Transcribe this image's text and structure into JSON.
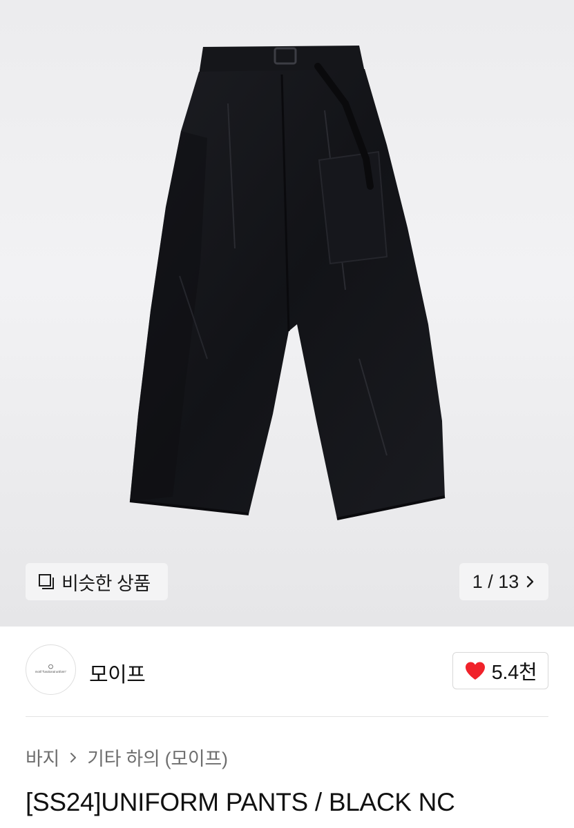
{
  "gallery": {
    "product_image_icon": "black-wide-pants-photo",
    "similar_button_label": "비슷한 상품",
    "similar_icon": "stacked-squares-icon",
    "pager_text": "1 / 13",
    "pager_icon": "chevron-right-icon"
  },
  "shop": {
    "avatar_icon": "shop-logo-avatar",
    "avatar_text": "motif \"functional uniform\"",
    "name": "모이프",
    "like_count": "5.4천",
    "like_icon": "heart-icon",
    "like_color": "#f0222a"
  },
  "breadcrumb": {
    "items": [
      "바지",
      "기타 하의 (모이프)"
    ],
    "separator_icon": "chevron-right-icon"
  },
  "product": {
    "title": "[SS24]UNIFORM PANTS / BLACK NC"
  }
}
